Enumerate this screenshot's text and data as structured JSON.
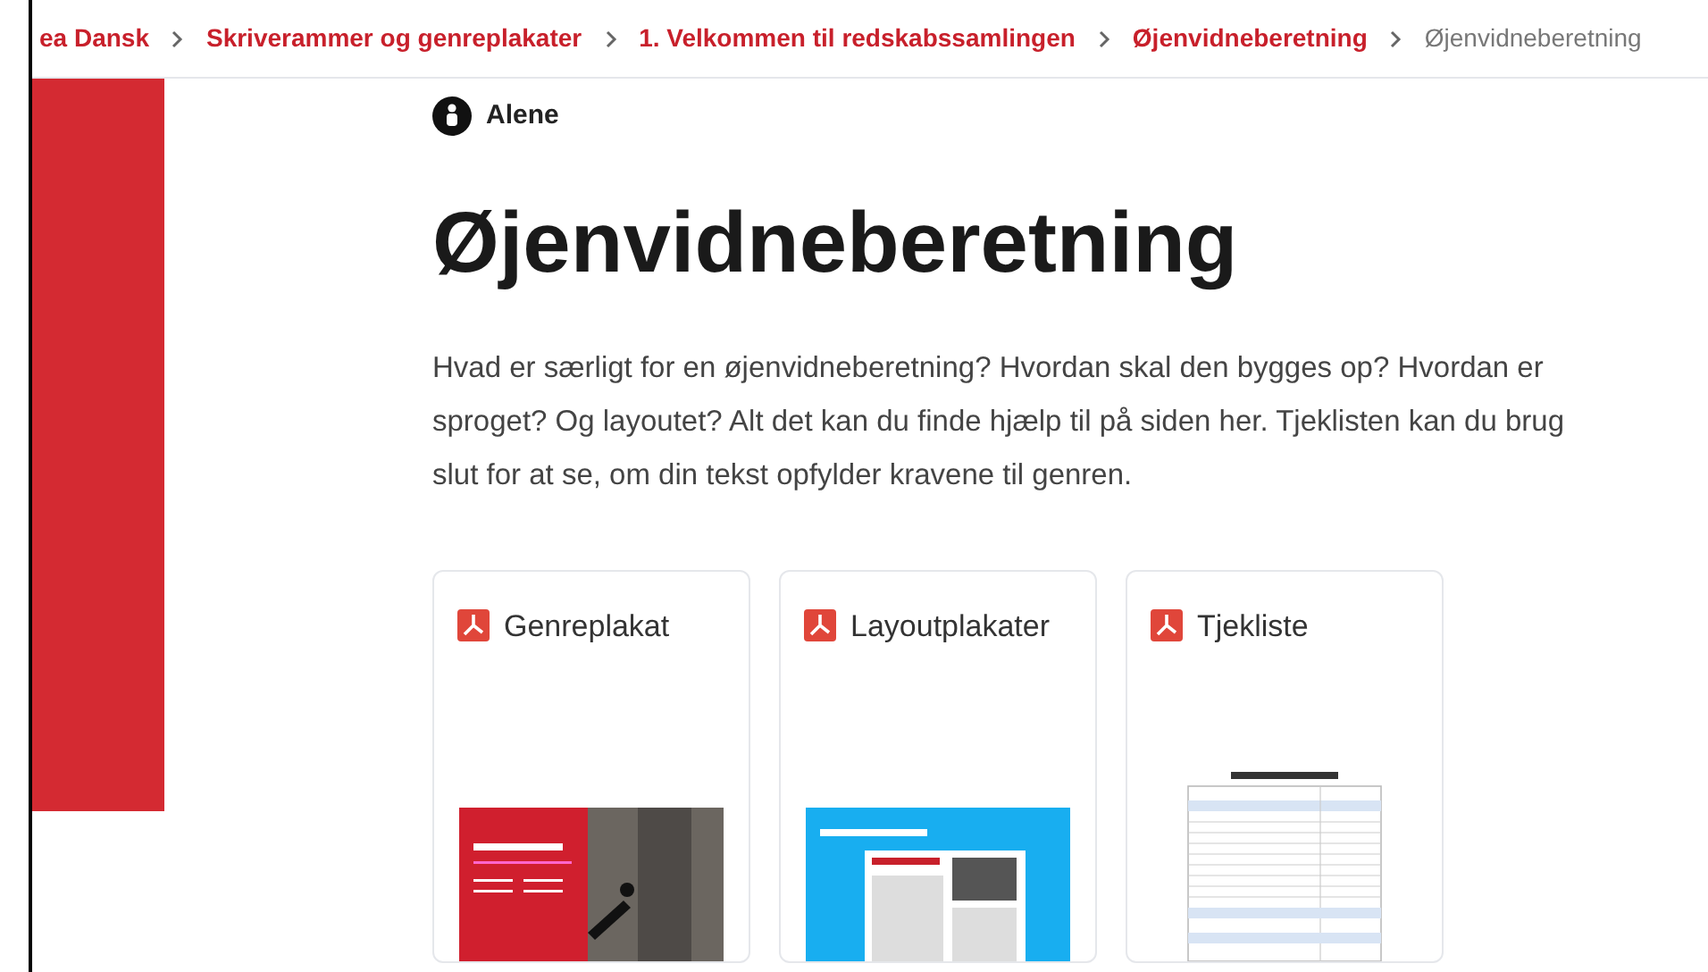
{
  "breadcrumb": [
    {
      "label": "ea Dansk",
      "current": false
    },
    {
      "label": "Skriverammer og genreplakater",
      "current": false
    },
    {
      "label": "1. Velkommen til redskabssamlingen",
      "current": false
    },
    {
      "label": "Øjenvidneberetning",
      "current": false
    },
    {
      "label": "Øjenvidneberetning",
      "current": true
    }
  ],
  "tag": {
    "label": "Alene"
  },
  "title": "Øjenvidneberetning",
  "intro_lines": [
    "Hvad er særligt for en øjenvidneberetning? Hvordan skal den bygges op? Hvordan er",
    "sproget? Og layoutet? Alt det kan du finde hjælp til på siden her. Tjeklisten kan du brug",
    "slut for at se, om din tekst opfylder kravene til genren."
  ],
  "cards": [
    {
      "label": "Genreplakat",
      "kind": "poster"
    },
    {
      "label": "Layoutplakater",
      "kind": "layout"
    },
    {
      "label": "Tjekliste",
      "kind": "checklist"
    }
  ]
}
